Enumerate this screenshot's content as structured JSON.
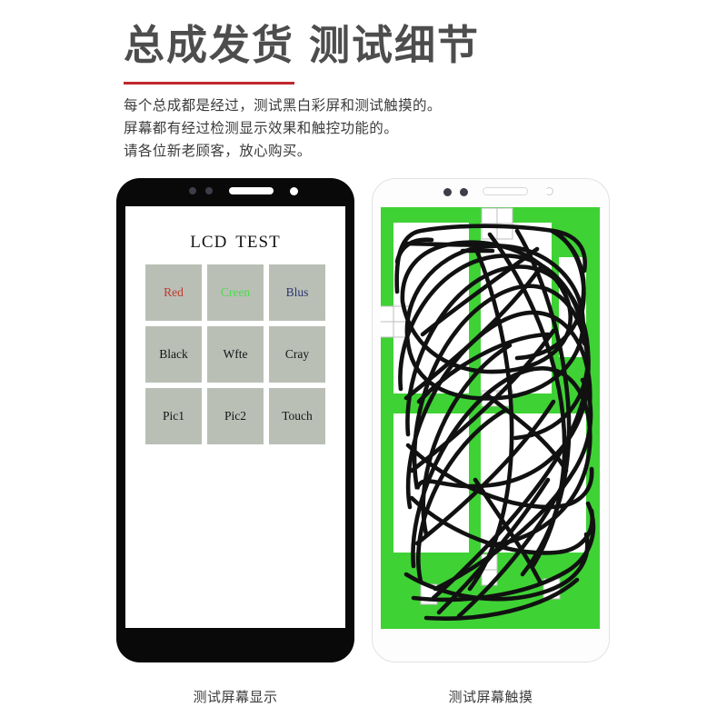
{
  "header": {
    "title_part1": "总成发货",
    "title_part2": "测试细节",
    "rule_color": "#c0272d",
    "body_lines": [
      "每个总成都是经过，测试黑白彩屏和测试触摸的。",
      "屏幕都有经过检测显示效果和触控功能的。",
      "请各位新老顾客，放心购买。"
    ]
  },
  "left_phone": {
    "frame_color": "#090909",
    "screen": {
      "heading_part1": "LCD",
      "heading_part2": "TEST",
      "grid": [
        {
          "label": "Red",
          "color": "#c0392b"
        },
        {
          "label": "Creen",
          "color": "#4bdc4b"
        },
        {
          "label": "Blus",
          "color": "#2c3470"
        },
        {
          "label": "Black",
          "color": "#141414"
        },
        {
          "label": "Wfte",
          "color": "#141414"
        },
        {
          "label": "Cray",
          "color": "#141414"
        },
        {
          "label": "Pic1",
          "color": "#141414"
        },
        {
          "label": "Pic2",
          "color": "#141414"
        },
        {
          "label": "Touch",
          "color": "#141414"
        }
      ],
      "cell_bg": "#babfb6"
    },
    "caption": "测试屏幕显示"
  },
  "right_phone": {
    "frame_color": "#fdfdfd",
    "screen": {
      "background_color": "#3fd235",
      "touched_color": "#ffffff",
      "stroke_color": "#111111"
    },
    "caption": "测试屏幕触摸"
  }
}
